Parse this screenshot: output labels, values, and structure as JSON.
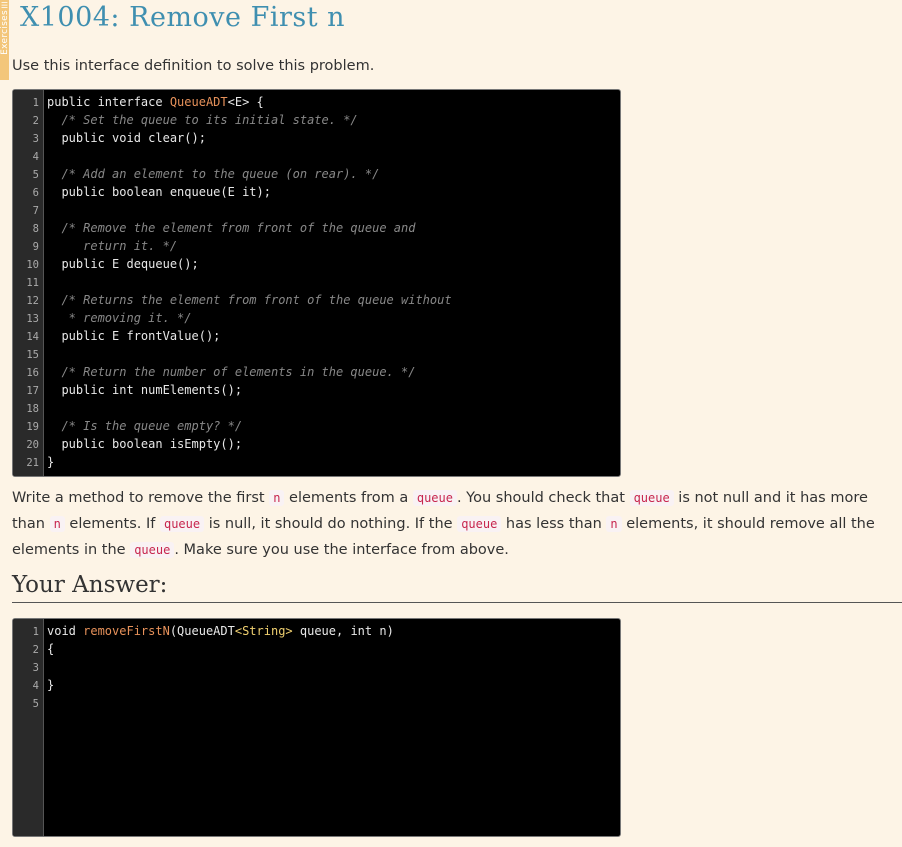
{
  "sidebar": {
    "label": "Exercises"
  },
  "title": "X1004: Remove First n",
  "intro": "Use this interface definition to solve this problem.",
  "interface_code": [
    {
      "n": "1",
      "parts": [
        {
          "t": "public interface ",
          "c": ""
        },
        {
          "t": "QueueADT",
          "c": "name"
        },
        {
          "t": "<E> {",
          "c": ""
        }
      ]
    },
    {
      "n": "2",
      "parts": [
        {
          "t": "  /* Set the queue to its initial state. */",
          "c": "cmt"
        }
      ]
    },
    {
      "n": "3",
      "parts": [
        {
          "t": "  public void clear();",
          "c": ""
        }
      ]
    },
    {
      "n": "4",
      "parts": []
    },
    {
      "n": "5",
      "parts": [
        {
          "t": "  /* Add an element to the queue (on rear). */",
          "c": "cmt"
        }
      ]
    },
    {
      "n": "6",
      "parts": [
        {
          "t": "  public boolean enqueue(E it);",
          "c": ""
        }
      ]
    },
    {
      "n": "7",
      "parts": []
    },
    {
      "n": "8",
      "parts": [
        {
          "t": "  /* Remove the element from front of the queue and",
          "c": "cmt"
        }
      ]
    },
    {
      "n": "9",
      "parts": [
        {
          "t": "     return it. */",
          "c": "cmt"
        }
      ]
    },
    {
      "n": "10",
      "parts": [
        {
          "t": "  public E dequeue();",
          "c": ""
        }
      ]
    },
    {
      "n": "11",
      "parts": []
    },
    {
      "n": "12",
      "parts": [
        {
          "t": "  /* Returns the element from front of the queue without",
          "c": "cmt"
        }
      ]
    },
    {
      "n": "13",
      "parts": [
        {
          "t": "   * removing it. */",
          "c": "cmt"
        }
      ]
    },
    {
      "n": "14",
      "parts": [
        {
          "t": "  public E frontValue();",
          "c": ""
        }
      ]
    },
    {
      "n": "15",
      "parts": []
    },
    {
      "n": "16",
      "parts": [
        {
          "t": "  /* Return the number of elements in the queue. */",
          "c": "cmt"
        }
      ]
    },
    {
      "n": "17",
      "parts": [
        {
          "t": "  public int numElements();",
          "c": ""
        }
      ]
    },
    {
      "n": "18",
      "parts": []
    },
    {
      "n": "19",
      "parts": [
        {
          "t": "  /* Is the queue empty? */",
          "c": "cmt"
        }
      ]
    },
    {
      "n": "20",
      "parts": [
        {
          "t": "  public boolean isEmpty();",
          "c": ""
        }
      ]
    },
    {
      "n": "21",
      "parts": [
        {
          "t": "}",
          "c": ""
        }
      ]
    }
  ],
  "problem": [
    {
      "t": "Write a method to remove the first "
    },
    {
      "t": "n",
      "code": true
    },
    {
      "t": " elements from a "
    },
    {
      "t": "queue",
      "code": true
    },
    {
      "t": ". You should check that "
    },
    {
      "t": "queue",
      "code": true
    },
    {
      "t": " is not null and it has more than "
    },
    {
      "t": "n",
      "code": true
    },
    {
      "t": " elements. If "
    },
    {
      "t": "queue",
      "code": true
    },
    {
      "t": " is null, it should do nothing. If the "
    },
    {
      "t": "queue",
      "code": true
    },
    {
      "t": " has less than "
    },
    {
      "t": "n",
      "code": true
    },
    {
      "t": " elements, it should remove all the elements in the "
    },
    {
      "t": "queue",
      "code": true
    },
    {
      "t": ". Make sure you use the interface from above."
    }
  ],
  "answer_heading": "Your Answer:",
  "answer_code": [
    {
      "n": "1",
      "parts": [
        {
          "t": "void ",
          "c": ""
        },
        {
          "t": "removeFirstN",
          "c": "name"
        },
        {
          "t": "(QueueADT",
          "c": ""
        },
        {
          "t": "<String>",
          "c": "ty"
        },
        {
          "t": " queue, int n)",
          "c": ""
        }
      ]
    },
    {
      "n": "2",
      "parts": [
        {
          "t": "{",
          "c": ""
        }
      ]
    },
    {
      "n": "3",
      "parts": []
    },
    {
      "n": "4",
      "parts": [
        {
          "t": "}",
          "c": ""
        }
      ]
    },
    {
      "n": "5",
      "parts": []
    }
  ]
}
